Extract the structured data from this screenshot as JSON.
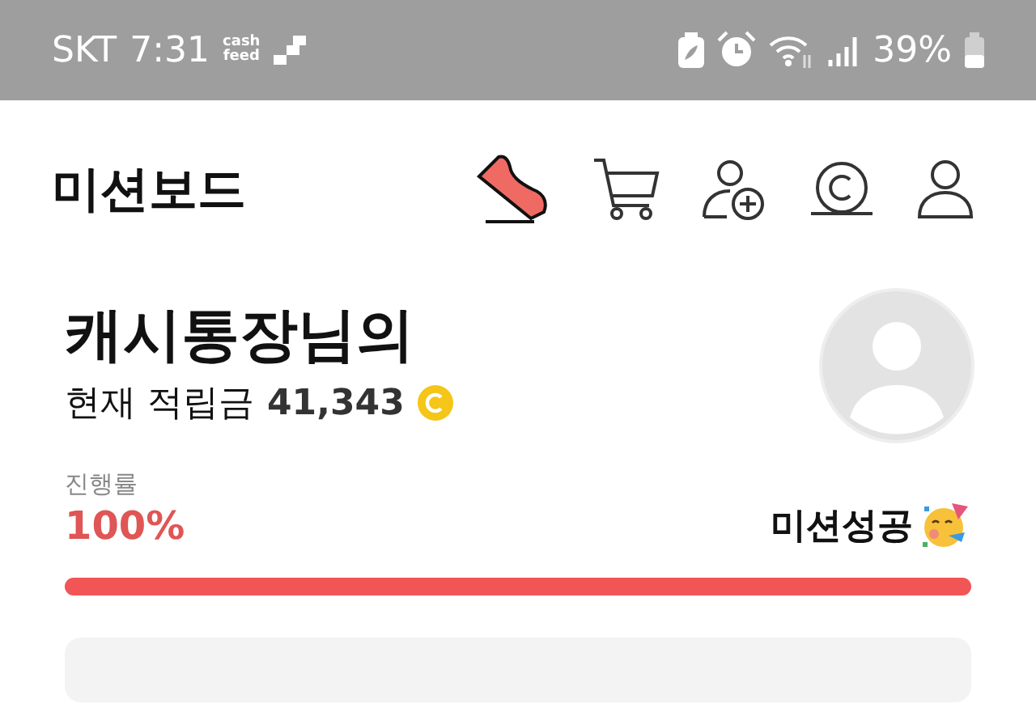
{
  "status_bar": {
    "carrier": "SKT",
    "time": "7:31",
    "app_logo": [
      "cash",
      "feed"
    ],
    "battery": "39%"
  },
  "header": {
    "title": "미션보드"
  },
  "profile": {
    "name": "캐시통장님의",
    "balance_label": "현재 적립금",
    "balance": "41,343"
  },
  "progress": {
    "label": "진행률",
    "percent": "100%",
    "status": "미션성공",
    "level": 1
  }
}
